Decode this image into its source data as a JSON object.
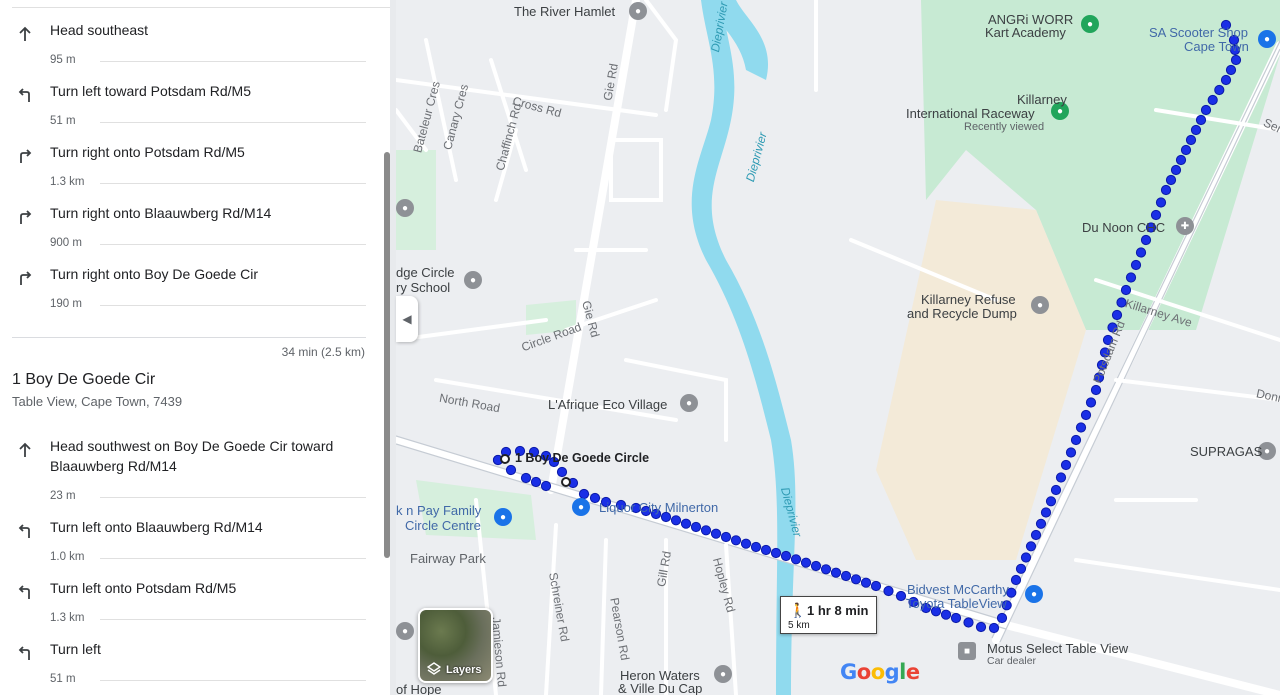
{
  "directions": {
    "leg1_steps": [
      {
        "icon": "straight-arrow-icon",
        "instruction": "Head southeast",
        "distance": "95 m"
      },
      {
        "icon": "turn-left-icon",
        "instruction": "Turn left toward Potsdam Rd/M5",
        "distance": "51 m"
      },
      {
        "icon": "turn-right-icon",
        "instruction": "Turn right onto Potsdam Rd/M5",
        "distance": "1.3 km"
      },
      {
        "icon": "turn-right-icon",
        "instruction": "Turn right onto Blaauwberg Rd/M14",
        "distance": "900 m"
      },
      {
        "icon": "turn-right-icon",
        "instruction": "Turn right onto Boy De Goede Cir",
        "distance": "190 m"
      }
    ],
    "leg1_summary": "34 min (2.5 km)",
    "destination": {
      "title": "1 Boy De Goede Cir",
      "subtitle": "Table View, Cape Town, 7439"
    },
    "leg2_steps": [
      {
        "icon": "straight-arrow-icon",
        "instruction": "Head southwest on Boy De Goede Cir toward Blaauwberg Rd/M14",
        "distance": "23 m"
      },
      {
        "icon": "turn-left-icon",
        "instruction": "Turn left onto Blaauwberg Rd/M14",
        "distance": "1.0 km"
      },
      {
        "icon": "turn-left-icon",
        "instruction": "Turn left onto Potsdam Rd/M5",
        "distance": "1.3 km"
      },
      {
        "icon": "turn-left-icon",
        "instruction": "Turn left",
        "distance": "51 m"
      }
    ]
  },
  "map": {
    "labels": {
      "river_hamlet": "The River Hamlet",
      "angri_1": "ANGRi WORR",
      "angri_2": "Kart Academy",
      "scooter_1": "SA Scooter Shop",
      "scooter_2": "Cape Town",
      "killarney_1": "Killarney",
      "killarney_2": "International Raceway",
      "recently_viewed": "Recently viewed",
      "du_noon": "Du Noon CHC",
      "refuse_1": "Killarney Refuse",
      "refuse_2": "and Recycle Dump",
      "killarney_ave": "Killarney Ave",
      "potsdam": "Potsdam Rd",
      "donnington": "Donnin",
      "supragas": "SUPRAGAS",
      "lafrique": "L'Afrique Eco Village",
      "boy_de_goede": "1 Boy De Goede Circle",
      "liquor_city": "Liquor City Milnerton",
      "pick_n_pay_1": "k n Pay Family",
      "pick_n_pay_2": "Circle Centre",
      "fairway": "Fairway Park",
      "bidvest_1": "Bidvest McCarthy",
      "bidvest_2": "Toyota TableView",
      "motus": "Motus Select Table View",
      "car_dealer": "Car dealer",
      "heron_1": "Heron Waters",
      "heron_2": "& Ville Du Cap",
      "hope": "of Hope",
      "edge_circle_1": "dge Circle",
      "edge_circle_2": "ry School",
      "gie_rd_1": "Gie Rd",
      "gie_rd_2": "Gie Rd",
      "cross_rd": "Cross Rd",
      "bateleur": "Bateleur Cres",
      "canary": "Canary Cres",
      "chaffinch": "Chaffinch Rd",
      "circle_road": "Circle Road",
      "north_road": "North Road",
      "diep_1": "Dieprivier",
      "diep_2": "Dieprivier",
      "diep_3": "Dieprivier",
      "gill_rd": "Gill Rd",
      "schreiner": "Schreiner Rd",
      "pearson": "Pearson Rd",
      "hopley": "Hopley Rd",
      "jamieson": "Jamieson Rd",
      "serv": "Serv"
    },
    "travel": {
      "time": "1 hr 8 min",
      "distance": "5 km",
      "mode_icon": "walking-person-icon"
    },
    "layers_label": "Layers",
    "logo": "Google",
    "colors": {
      "route": "#1a2fe6",
      "route_outline": "#0b1aa8",
      "water": "#90daee",
      "park": "#c7ead3",
      "sand": "#f3ead8"
    }
  }
}
